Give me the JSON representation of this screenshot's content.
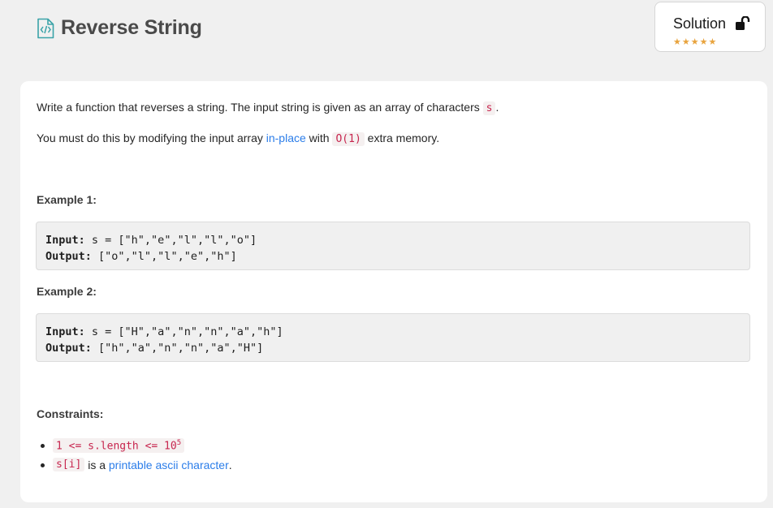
{
  "header": {
    "title": "Reverse String"
  },
  "solution": {
    "label": "Solution",
    "star_count": 5,
    "star_color": "#e8a33d"
  },
  "description": {
    "line1_text": "Write a function that reverses a string. The input string is given as an array of characters ",
    "line1_code": "s",
    "line1_end": ".",
    "line2_pre": "You must do this by modifying the input array ",
    "line2_link": "in-place",
    "line2_mid": " with ",
    "line2_code": "O(1)",
    "line2_post": " extra memory."
  },
  "examples": [
    {
      "heading": "Example 1:",
      "input_label": "Input:",
      "input_value": " s = [\"h\",\"e\",\"l\",\"l\",\"o\"]",
      "output_label": "Output:",
      "output_value": " [\"o\",\"l\",\"l\",\"e\",\"h\"]"
    },
    {
      "heading": "Example 2:",
      "input_label": "Input:",
      "input_value": " s = [\"H\",\"a\",\"n\",\"n\",\"a\",\"h\"]",
      "output_label": "Output:",
      "output_value": " [\"h\",\"a\",\"n\",\"n\",\"a\",\"H\"]"
    }
  ],
  "constraints": {
    "heading": "Constraints:",
    "item1_code": "1 <= s.length <= 10",
    "item1_sup": "5",
    "item2_code": "s[i]",
    "item2_mid": " is a ",
    "item2_link": "printable ascii character",
    "item2_end": "."
  },
  "colors": {
    "accent": "#2b7de9",
    "code_text": "#c7254e",
    "icon_teal": "#3aa3a8"
  }
}
